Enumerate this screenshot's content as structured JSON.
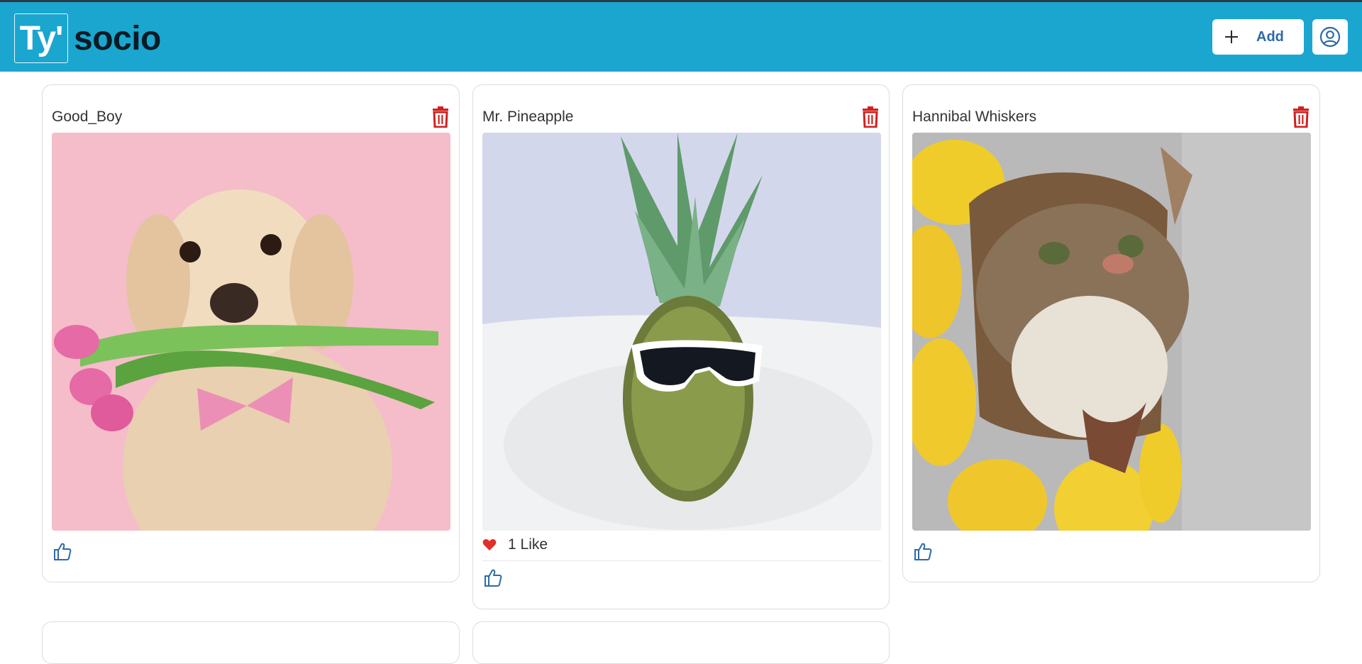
{
  "app": {
    "logo_mark": "Ty'",
    "logo_text": "socio"
  },
  "header": {
    "add_label": "Add",
    "icons": {
      "add": "plus-icon",
      "profile": "user-circle-icon"
    }
  },
  "colors": {
    "header_bg": "#1aa6cf",
    "accent": "#2f6aa5",
    "delete": "#d1201f",
    "heart": "#e0302c"
  },
  "posts": [
    {
      "title": "Good_Boy",
      "image": "golden retriever with tulips and pink bow tie on pink background",
      "likes_text": ""
    },
    {
      "title": "Mr. Pineapple",
      "image": "pineapple wearing sunglasses on white pillow",
      "likes_text": "1 Like"
    },
    {
      "title": "Hannibal Whiskers",
      "image": "tabby cat in yellow sunflower costume",
      "likes_text": ""
    }
  ]
}
